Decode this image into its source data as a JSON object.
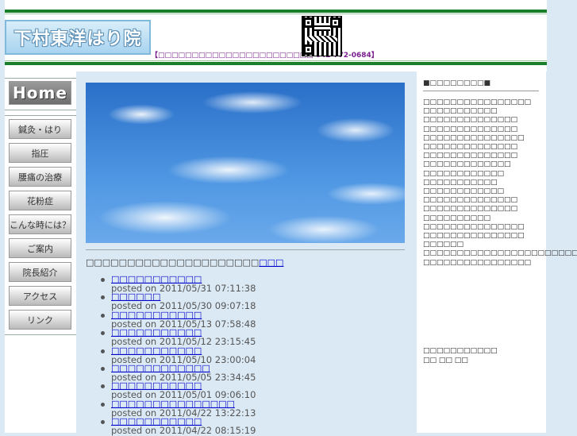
{
  "header": {
    "logo_text": "下村東洋はり院",
    "contact": "【□□□□□□□□□□□□□□□□□□□□□□□ 042-772-0684】",
    "qr_label": "qr-code"
  },
  "nav": {
    "home_label": "Home",
    "items": [
      {
        "label": "鍼灸・はり"
      },
      {
        "label": "指圧"
      },
      {
        "label": "腰痛の治療"
      },
      {
        "label": "花粉症"
      },
      {
        "label": "こんな時には？"
      },
      {
        "label": "ご案内"
      },
      {
        "label": "院長紹介"
      },
      {
        "label": "アクセス"
      },
      {
        "label": "リンク"
      }
    ]
  },
  "main": {
    "heading_text": "□□□□□□□□□□□□□□□□□□□□□",
    "heading_link": "□□□",
    "news": [
      {
        "title": "□□□□□□□□□□□",
        "posted": "posted on 2011/05/31 07:11:38"
      },
      {
        "title": "□□□□□□",
        "posted": "posted on 2011/05/30 09:07:18"
      },
      {
        "title": "□□□□□□□□□□□",
        "posted": "posted on 2011/05/13 07:58:48"
      },
      {
        "title": "□□□□□□□□□□□",
        "posted": "posted on 2011/05/12 23:15:45"
      },
      {
        "title": "□□□□□□□□□□□",
        "posted": "posted on 2011/05/10 23:00:04"
      },
      {
        "title": "□□□□□□□□□□□□",
        "posted": "posted on 2011/05/05 23:34:45"
      },
      {
        "title": "□□□□□□□□□□□",
        "posted": "posted on 2011/05/01 09:06:10"
      },
      {
        "title": "□□□□□□□□□□□□□□□",
        "posted": "posted on 2011/04/22 13:22:13"
      },
      {
        "title": "□□□□□□□□□□□",
        "posted": "posted on 2011/04/22 08:15:19"
      }
    ]
  },
  "right": {
    "title": "■□□□□□□□□■",
    "items": [
      "□□□□□□□□□□□□□□□□",
      "□□□□□□□□□□□",
      "□□□□□□□□□□□□□□",
      "□□□□□□□□□□□□□□",
      "□□□□□□□□□□□□□□□",
      "□□□□□□□□□□□□□□",
      "□□□□□□□□□□□□□□",
      "□□□□□□□□□□□□□",
      "□□□□□□□□□□□□",
      "□□□□□□□□□□□",
      "□□□□□□□□□□□□",
      "□□□□□□□□□□□□□□",
      "□□□□□□□□□□□□□□",
      "□□□□□□□□□□",
      "□□□□□□□□□□□□□□□",
      "□□□□□□□□□□□□□□□",
      "□□□□□□",
      "□□□□□□□□□□□□□□□□□□□□□□□□□□",
      "□□□□□□□□□□□□□□□□"
    ],
    "bottom_line1": "□□□□□□□□□□□",
    "bottom_line2": "□□ □□ □□"
  }
}
